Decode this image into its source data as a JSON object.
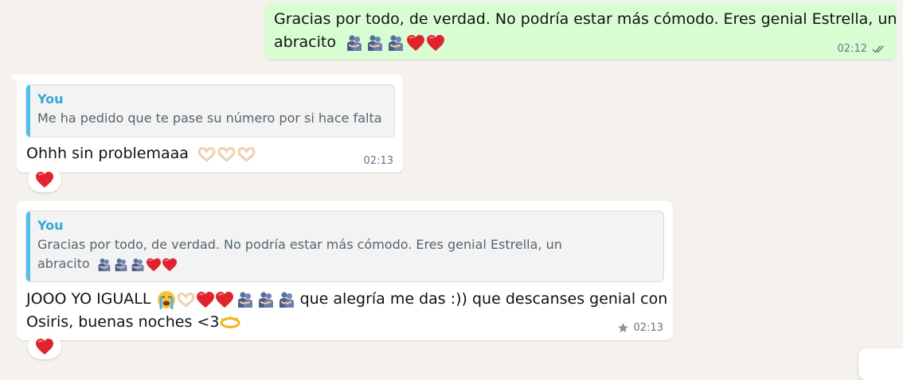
{
  "messages": [
    {
      "text_line1": "Gracias por todo, de verdad. No podría estar más cómodo. Eres genial Estrella, un",
      "text_line2": "abracito",
      "time": "02:12"
    },
    {
      "quote_author": "You",
      "quote_text": "Me ha pedido que te pase su número por si hace falta",
      "text": "Ohhh sin problemaaa",
      "time": "02:13"
    },
    {
      "quote_author": "You",
      "quote_line1": "Gracias por todo, de verdad. No podría estar más cómodo. Eres genial Estrella, un",
      "quote_line2": "abracito",
      "text_part1": "JOOO YO IGUALL",
      "text_part2": "que alegría me das :)) que descanses genial con",
      "text_line2": "Osiris, buenas noches <3",
      "time": "02:13"
    }
  ],
  "icons": {
    "read_receipt": "double-check-icon",
    "star": "star-icon",
    "reaction": "heart-icon",
    "hug": "people-hugging-icon",
    "heart_hands": "heart-hands-icon",
    "crying": "crying-face-icon",
    "halo": "halo-icon"
  },
  "colors": {
    "outgoing_bubble": "#d9fdd3",
    "incoming_bubble": "#ffffff",
    "quote_accent": "#53bdeb",
    "heart": "#e0242e"
  }
}
